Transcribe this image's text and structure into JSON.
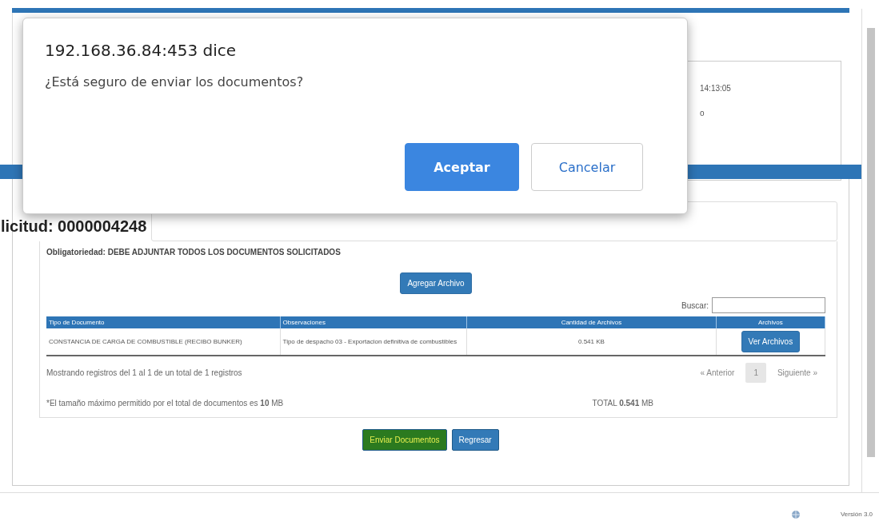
{
  "background_fragments": [
    "14:13:05",
    "o"
  ],
  "heading": "licitud: 0000004248",
  "requirement": "Obligatoriedad: DEBE ADJUNTAR TODOS LOS DOCUMENTOS SOLICITADOS",
  "add_button": "Agregar Archivo",
  "search": {
    "label": "Buscar:"
  },
  "table": {
    "columns": [
      "Tipo de Documento",
      "Observaciones",
      "Cantidad de Archivos",
      "Archivos"
    ],
    "rows": [
      {
        "document_type": "CONSTANCIA DE CARGA DE COMBUSTIBLE (RECIBO BUNKER)",
        "observations": "Tipo de despacho 03 - Exportacion definitiva de combustibles",
        "size": "0.541 KB",
        "button": "Ver Archivos"
      }
    ]
  },
  "table_info": "Mostrando registros del 1 al 1 de un total de 1 registros",
  "pagination": [
    {
      "label": "« Anterior",
      "selected": false
    },
    {
      "label": "1",
      "selected": true
    },
    {
      "label": "Siguiente »",
      "selected": false
    }
  ],
  "size_note": "*El tamaño máximo permitido por el total de documentos es **10** MB",
  "total": "TOTAL **0.541** MB",
  "buttons": [
    {
      "label": "Enviar Documentos",
      "kind": "primary"
    },
    {
      "label": "Regresar",
      "kind": "secondary"
    }
  ],
  "version": "Versión 3.0",
  "dialog": {
    "title": "192.168.36.84:453 dice",
    "message": "¿Está seguro de enviar los documentos?",
    "buttons": [
      {
        "label": "Aceptar",
        "kind": "primary"
      },
      {
        "label": "Cancelar",
        "kind": "secondary"
      }
    ]
  }
}
